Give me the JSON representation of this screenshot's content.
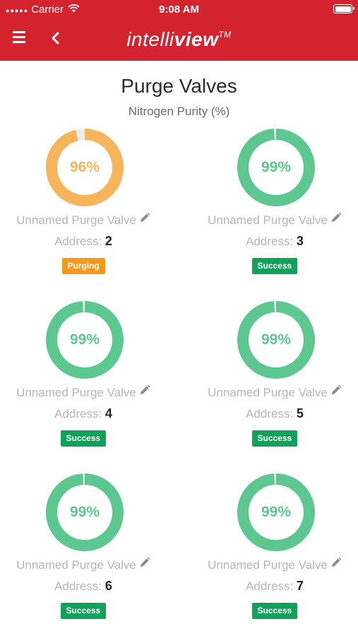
{
  "status_bar": {
    "carrier": "Carrier",
    "time": "9:08 AM"
  },
  "nav": {
    "logo_light": "intelli",
    "logo_bold": "view",
    "logo_tm": "TM"
  },
  "page": {
    "title": "Purge Valves",
    "subtitle": "Nitrogen Purity (%)"
  },
  "colors": {
    "header_red": "#d2232f",
    "purging": "#f6b55a",
    "purging_badge": "#f39a1e",
    "success": "#5cc78f",
    "success_badge": "#12a15b",
    "track": "#ececec"
  },
  "valves": [
    {
      "purity_label": "96%",
      "purity": 96,
      "name": "Unnamed Purge Valve",
      "address_label": "Address:",
      "address": "2",
      "status": "Purging",
      "state": "purging"
    },
    {
      "purity_label": "99%",
      "purity": 99,
      "name": "Unnamed Purge Valve",
      "address_label": "Address:",
      "address": "3",
      "status": "Success",
      "state": "success"
    },
    {
      "purity_label": "99%",
      "purity": 99,
      "name": "Unnamed Purge Valve",
      "address_label": "Address:",
      "address": "4",
      "status": "Success",
      "state": "success"
    },
    {
      "purity_label": "99%",
      "purity": 99,
      "name": "Unnamed Purge Valve",
      "address_label": "Address:",
      "address": "5",
      "status": "Success",
      "state": "success"
    },
    {
      "purity_label": "99%",
      "purity": 99,
      "name": "Unnamed Purge Valve",
      "address_label": "Address:",
      "address": "6",
      "status": "Success",
      "state": "success"
    },
    {
      "purity_label": "99%",
      "purity": 99,
      "name": "Unnamed Purge Valve",
      "address_label": "Address:",
      "address": "7",
      "status": "Success",
      "state": "success"
    }
  ]
}
